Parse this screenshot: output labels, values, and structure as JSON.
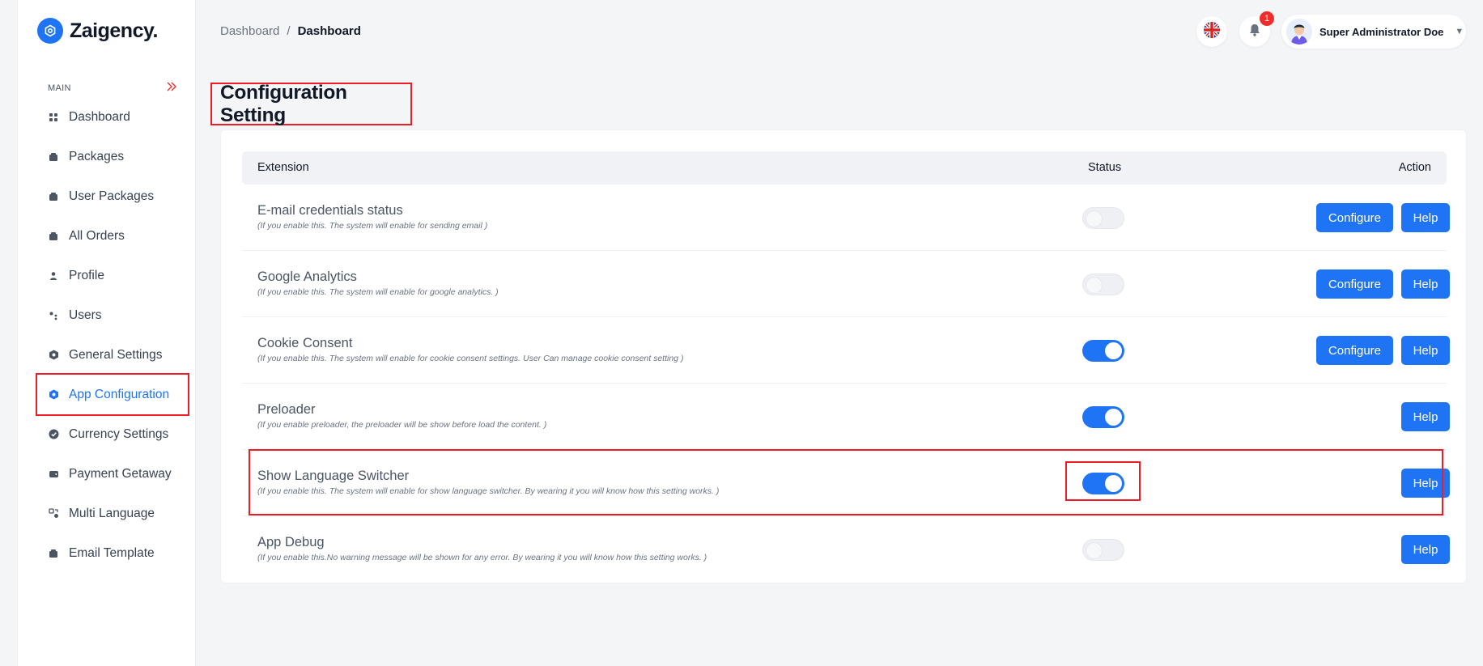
{
  "brand": {
    "name": "Zaigency.",
    "color": "#1e74f5"
  },
  "sidebar": {
    "section_label": "MAIN",
    "items": [
      {
        "label": "Dashboard",
        "icon": "grid-icon",
        "active": false
      },
      {
        "label": "Packages",
        "icon": "package-icon",
        "active": false
      },
      {
        "label": "User Packages",
        "icon": "package-icon",
        "active": false
      },
      {
        "label": "All Orders",
        "icon": "package-icon",
        "active": false
      },
      {
        "label": "Profile",
        "icon": "user-icon",
        "active": false
      },
      {
        "label": "Users",
        "icon": "users-icon",
        "active": false
      },
      {
        "label": "General Settings",
        "icon": "settings-hex-icon",
        "active": false
      },
      {
        "label": "App Configuration",
        "icon": "settings-hex-icon",
        "active": true
      },
      {
        "label": "Currency Settings",
        "icon": "check-badge-icon",
        "active": false
      },
      {
        "label": "Payment Getaway",
        "icon": "wallet-icon",
        "active": false
      },
      {
        "label": "Multi Language",
        "icon": "translate-icon",
        "active": false
      },
      {
        "label": "Email Template",
        "icon": "package-icon",
        "active": false
      }
    ]
  },
  "header": {
    "breadcrumb": {
      "parent": "Dashboard",
      "separator": "/",
      "current": "Dashboard"
    },
    "notification_count": "1",
    "user_name": "Super Administrator Doe",
    "language_icon": "uk-flag-icon"
  },
  "page": {
    "title": "Configuration Setting"
  },
  "table": {
    "headers": {
      "extension": "Extension",
      "status": "Status",
      "action": "Action"
    },
    "configure_label": "Configure",
    "help_label": "Help",
    "rows": [
      {
        "title": "E-mail credentials status",
        "description": "(If you enable this. The system will enable for sending email )",
        "enabled": false,
        "configurable": true
      },
      {
        "title": "Google Analytics",
        "description": "(If you enable this. The system will enable for google analytics. )",
        "enabled": false,
        "configurable": true
      },
      {
        "title": "Cookie Consent",
        "description": "(If you enable this. The system will enable for cookie consent settings. User Can manage cookie consent setting )",
        "enabled": true,
        "configurable": true
      },
      {
        "title": "Preloader",
        "description": "(If you enable preloader, the preloader will be show before load the content. )",
        "enabled": true,
        "configurable": false
      },
      {
        "title": "Show Language Switcher",
        "description": "(If you enable this. The system will enable for show language switcher. By wearing it you will know how this setting works. )",
        "enabled": true,
        "configurable": false
      },
      {
        "title": "App Debug",
        "description": "(If you enable this.No warning message will be shown for any error. By wearing it you will know how this setting works. )",
        "enabled": false,
        "configurable": false
      }
    ]
  },
  "colors": {
    "accent": "#1e74f5",
    "highlight": "#ee1c25",
    "badge": "#ef2d2d"
  }
}
